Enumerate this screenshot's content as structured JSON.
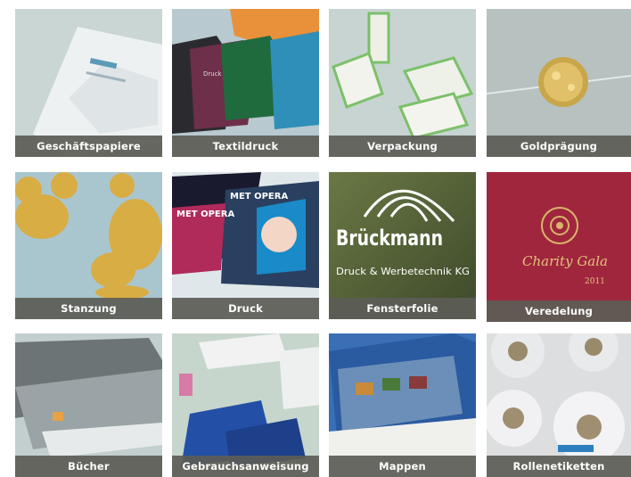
{
  "tiles": [
    {
      "label": "Geschäftspapiere"
    },
    {
      "label": "Textildruck"
    },
    {
      "label": "Verpackung"
    },
    {
      "label": "Goldprägung"
    },
    {
      "label": "Stanzung"
    },
    {
      "label": "Druck"
    },
    {
      "label": "Fensterfolie"
    },
    {
      "label": "Veredelung"
    },
    {
      "label": "Bücher"
    },
    {
      "label": "Gebrauchsanweisung"
    },
    {
      "label": "Mappen"
    },
    {
      "label": "Rollenetiketten"
    }
  ],
  "images": {
    "druck_poster_text": "MET OPERA",
    "fensterfolie_brand": "Brückmann",
    "fensterfolie_subtitle": "Druck & Werbetechnik KG",
    "veredelung_script": "Charity Gala",
    "veredelung_year": "2011"
  }
}
